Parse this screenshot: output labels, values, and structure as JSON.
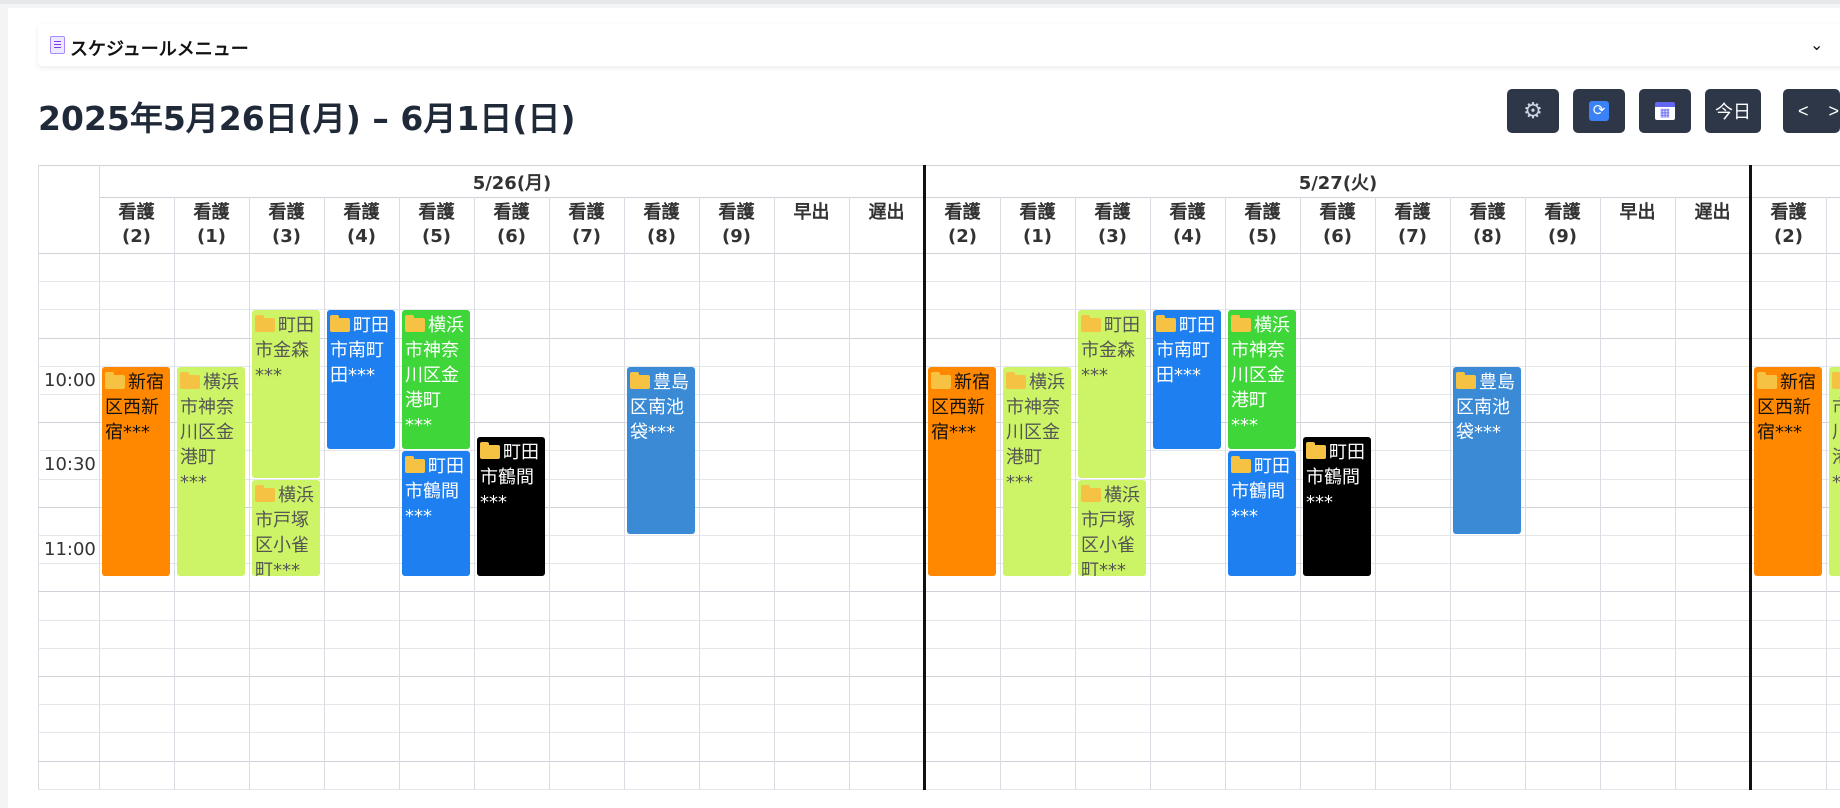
{
  "menu": {
    "label": "スケジュールメニュー",
    "chevron": "⌄",
    "icon": "memo-icon"
  },
  "title": "2025年5月26日(月) – 6月1日(日)",
  "toolbar": {
    "settings_icon": "⚙",
    "refresh_icon": "⟳",
    "calendar_icon": "▦",
    "today_label": "今日",
    "prev_label": "<",
    "next_label": ">"
  },
  "days": [
    "5/26(月)",
    "5/27(火)"
  ],
  "columns": [
    "看護\n(2)",
    "看護\n(1)",
    "看護\n(3)",
    "看護\n(4)",
    "看護\n(5)",
    "看護\n(6)",
    "看護\n(7)",
    "看護\n(8)",
    "看護\n(9)",
    "早出",
    "遅出"
  ],
  "extra_column": "看護\n(2)",
  "times": [
    "10:00",
    "10:30",
    "11:00"
  ],
  "colors": {
    "orange": "#ff8800",
    "lime": "#ccf466",
    "blue": "#1e7ff0",
    "green": "#3fd63a",
    "black": "#000000",
    "steel": "#3a8ad6"
  },
  "events": [
    {
      "col": 0,
      "start": "10:00",
      "end": "11:15",
      "text": "新宿区西新宿***",
      "color": "orange",
      "text_color": "#111111"
    },
    {
      "col": 1,
      "start": "10:00",
      "end": "11:15",
      "text": "横浜市神奈川区金港町***",
      "color": "lime",
      "text_color": "#555555"
    },
    {
      "col": 2,
      "start": "09:40",
      "end": "10:40",
      "text": "町田市金森***",
      "color": "lime",
      "text_color": "#555555"
    },
    {
      "col": 2,
      "start": "10:40",
      "end": "11:15",
      "text": "横浜市戸塚区小雀町***",
      "color": "lime",
      "text_color": "#555555"
    },
    {
      "col": 3,
      "start": "09:40",
      "end": "10:30",
      "text": "町田市南町田***",
      "color": "blue",
      "text_color": "#ffffff"
    },
    {
      "col": 4,
      "start": "09:40",
      "end": "10:30",
      "text": "横浜市神奈川区金港町***",
      "color": "green",
      "text_color": "#ffffff"
    },
    {
      "col": 4,
      "start": "10:30",
      "end": "11:15",
      "text": "町田市鶴間***",
      "color": "blue",
      "text_color": "#ffffff"
    },
    {
      "col": 5,
      "start": "10:25",
      "end": "11:15",
      "text": "町田市鶴間***",
      "color": "black",
      "text_color": "#ffffff"
    },
    {
      "col": 7,
      "start": "10:00",
      "end": "11:00",
      "text": "豊島区南池袋***",
      "color": "steel",
      "text_color": "#ffffff"
    }
  ],
  "extra_event": {
    "text": "新宿区西新宿***",
    "color": "orange",
    "text_color": "#111111"
  },
  "extra_event_partial": {
    "text": "横浜市神奈川区金港町***",
    "color": "lime",
    "text_color": "#555555"
  }
}
